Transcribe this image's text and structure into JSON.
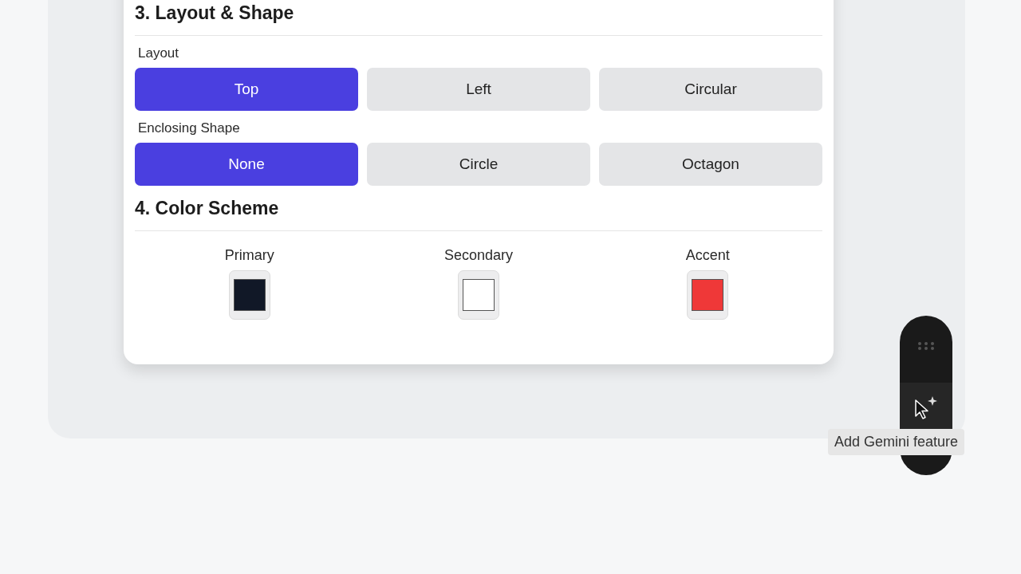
{
  "sections": [
    {
      "title": "3. Layout & Shape",
      "groups": [
        {
          "label": "Layout",
          "options": [
            {
              "label": "Top",
              "selected": true
            },
            {
              "label": "Left",
              "selected": false
            },
            {
              "label": "Circular",
              "selected": false
            }
          ]
        },
        {
          "label": "Enclosing Shape",
          "options": [
            {
              "label": "None",
              "selected": true
            },
            {
              "label": "Circle",
              "selected": false
            },
            {
              "label": "Octagon",
              "selected": false
            }
          ]
        }
      ]
    },
    {
      "title": "4. Color Scheme",
      "swatches": [
        {
          "label": "Primary",
          "color": "#111827"
        },
        {
          "label": "Secondary",
          "color": "#ffffff"
        },
        {
          "label": "Accent",
          "color": "#ef3838"
        }
      ]
    }
  ],
  "toolbar": {
    "tooltip": "Add Gemini feature"
  }
}
